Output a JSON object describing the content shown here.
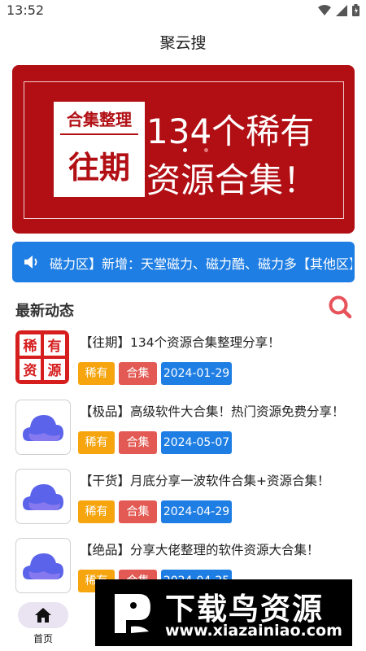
{
  "status_bar": {
    "time": "13:52"
  },
  "app": {
    "title": "聚云搜"
  },
  "banner": {
    "box_top": "合集整理",
    "box_bottom": "往期",
    "headline_line1": "134个稀有",
    "headline_line2": "资源合集！"
  },
  "notice": {
    "text": "磁力区】新增：天堂磁力、磁力酷、磁力多【其他区】"
  },
  "feed": {
    "section_title": "最新动态",
    "items": [
      {
        "title": "【往期】134个资源合集整理分享！",
        "tags": [
          "稀有",
          "合集"
        ],
        "date": "2024-01-29",
        "thumb": "archive-icon",
        "thumb_chars": [
          "稀",
          "有",
          "资",
          "源"
        ]
      },
      {
        "title": "【极品】高级软件大合集！热门资源免费分享！",
        "tags": [
          "稀有",
          "合集"
        ],
        "date": "2024-05-07",
        "thumb": "cloud-icon"
      },
      {
        "title": "【干货】月底分享一波软件合集+资源合集！",
        "tags": [
          "稀有",
          "合集"
        ],
        "date": "2024-04-29",
        "thumb": "cloud-icon"
      },
      {
        "title": "【绝品】分享大佬整理的软件资源大合集！",
        "tags": [
          "稀有",
          "合集"
        ],
        "date": "2024-04-25",
        "thumb": "cloud-icon"
      }
    ]
  },
  "bottom_nav": {
    "home_label": "首页"
  },
  "watermark": {
    "title": "下载鸟资源",
    "url": "www.xiazainiao.com"
  },
  "colors": {
    "brand_red": "#b10f14",
    "accent_blue": "#1f7ee3",
    "tag_orange": "#f6a50f",
    "tag_red": "#e25a53",
    "search_pink": "#e8525a"
  }
}
